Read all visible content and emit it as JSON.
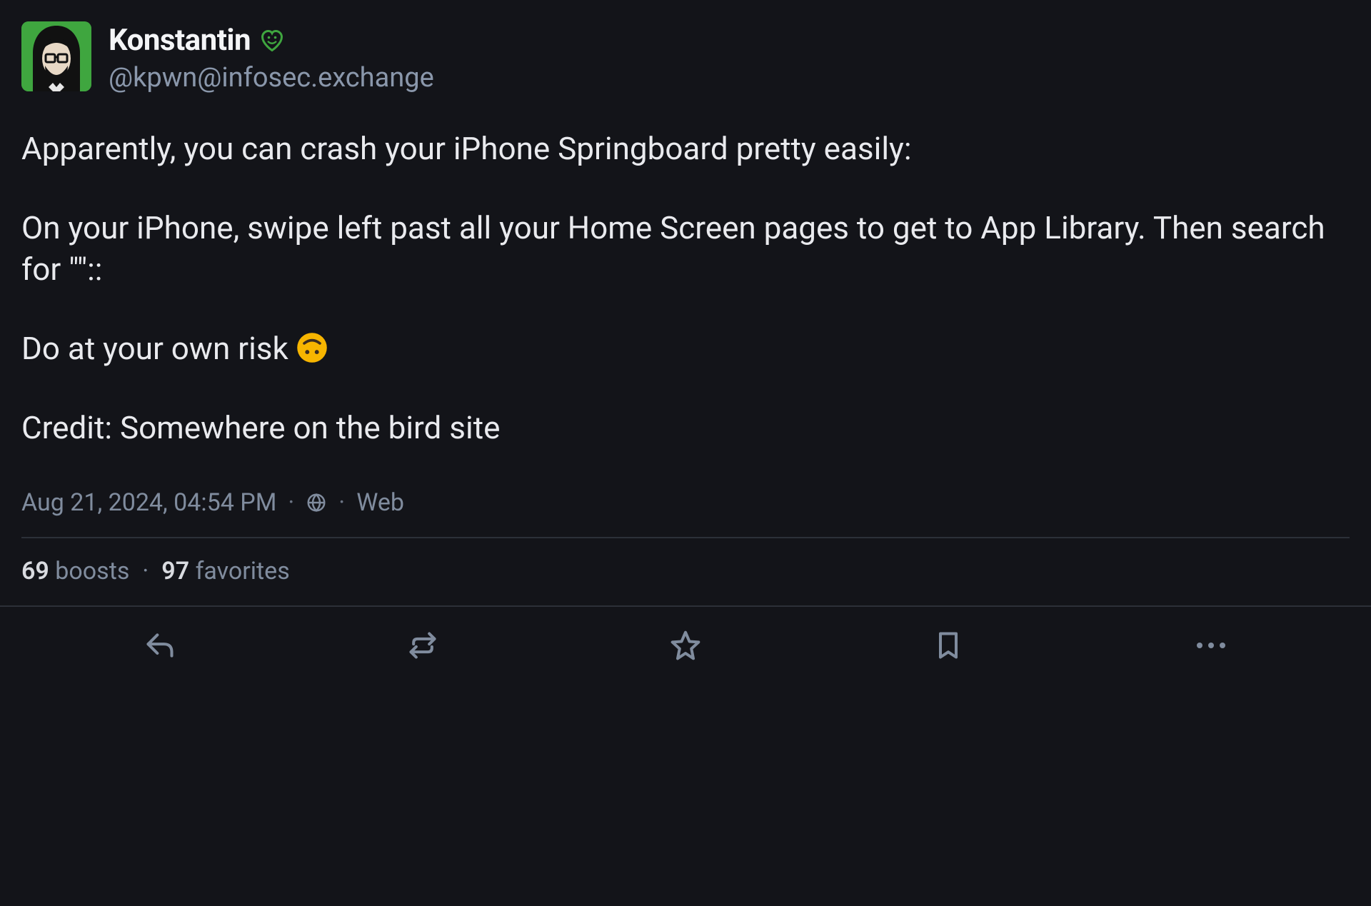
{
  "author": {
    "display_name": "Konstantin",
    "handle": "@kpwn@infosec.exchange"
  },
  "content": {
    "p1": "Apparently, you can crash your iPhone Springboard pretty easily:",
    "p2": "On your iPhone, swipe left past all your Home Screen pages to get to App Library. Then search for \"\"::",
    "p3_prefix": "Do at your own risk ",
    "p4": "Credit: Somewhere on the bird site"
  },
  "meta": {
    "timestamp": "Aug 21, 2024, 04:54 PM",
    "visibility": "public",
    "client": "Web"
  },
  "stats": {
    "boosts_count": "69",
    "boosts_label": "boosts",
    "favorites_count": "97",
    "favorites_label": "favorites"
  },
  "icons": {
    "verification": "heart-verified-icon",
    "visibility": "globe-icon",
    "risk_emoji": "upside-down-face"
  },
  "colors": {
    "bg": "#131419",
    "text_primary": "#e9eaee",
    "text_secondary": "#808c9e",
    "divider": "#2c3038",
    "avatar_bg": "#3fa63f",
    "badge": "#3fa63f"
  }
}
